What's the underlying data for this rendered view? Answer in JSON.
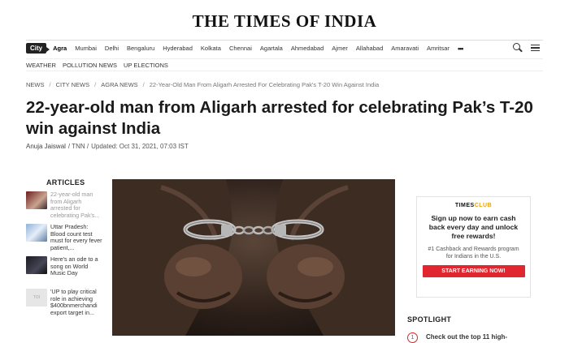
{
  "masthead": {
    "title": "THE TIMES OF INDIA"
  },
  "city_nav": {
    "badge": "City",
    "cities": [
      "Agra",
      "Mumbai",
      "Delhi",
      "Bengaluru",
      "Hyderabad",
      "Kolkata",
      "Chennai",
      "Agartala",
      "Ahmedabad",
      "Ajmer",
      "Allahabad",
      "Amaravati",
      "Amritsar"
    ],
    "more": "•••",
    "search_icon": "search-icon",
    "menu_icon": "hamburger-menu-icon"
  },
  "sub_nav": {
    "links": [
      "WEATHER",
      "POLLUTION NEWS",
      "UP ELECTIONS"
    ]
  },
  "breadcrumb": {
    "items": [
      "NEWS",
      "CITY NEWS",
      "AGRA NEWS",
      "22-Year-Old Man From Aligarh Arrested For Celebrating Pak's T-20 Win Against India"
    ],
    "separator": "/"
  },
  "article": {
    "headline": "22-year-old man from Aligarh arrested for celebrating Pak’s T-20 win against India",
    "author": "Anuja Jaiswal",
    "source": "/ TNN /",
    "updated": "Updated: Oct 31, 2021, 07:03 IST"
  },
  "articles_sidebar": {
    "heading": "ARTICLES",
    "items": [
      {
        "title": "22-year-old man from Aligarh arrested for celebrating Pak's..."
      },
      {
        "title": "Uttar Pradesh: Blood count test must for every fever patient,..."
      },
      {
        "title": "Here's an ode to a song on World Music Day"
      },
      {
        "title": "'UP to play critical role in achieving $400bnmerchandi export target in..."
      }
    ],
    "placeholder_thumb_text": "TOI"
  },
  "ad": {
    "logo_main": "TIMES",
    "logo_accent": "CLUB",
    "heading": "Sign up now to earn cash back every day and unlock free rewards!",
    "subtext": "#1 Cashback and Rewards program for Indians in the U.S.",
    "cta": "START EARNING NOW!",
    "accent_color": "#e0262e"
  },
  "spotlight": {
    "heading": "SPOTLIGHT",
    "items": [
      {
        "number": "1",
        "text": "Check out the top 11 high-"
      }
    ]
  }
}
